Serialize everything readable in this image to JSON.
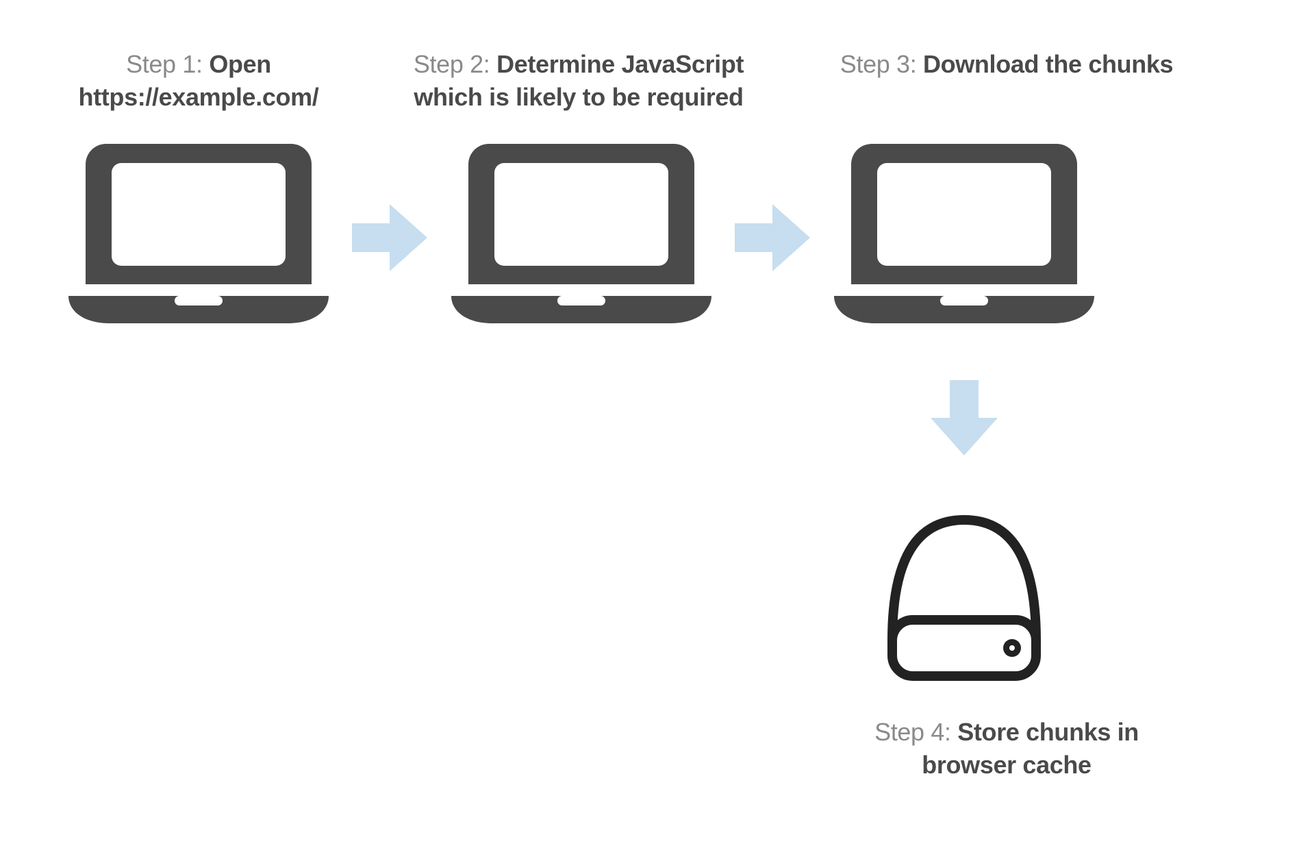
{
  "colors": {
    "laptop": "#4a4a4a",
    "arrow": "#c6deef",
    "drive_stroke": "#222222",
    "text_prefix": "#8a8a8a",
    "text_bold": "#4a4a4a"
  },
  "steps": {
    "s1": {
      "prefix": "Step 1: ",
      "bold": "Open https://example.com/"
    },
    "s2": {
      "prefix": "Step 2: ",
      "bold": "Determine JavaScript which is likely to be required"
    },
    "s3": {
      "prefix": "Step 3: ",
      "bold": "Download the chunks"
    },
    "s4": {
      "prefix": "Step 4: ",
      "bold": "Store chunks in browser cache"
    }
  }
}
